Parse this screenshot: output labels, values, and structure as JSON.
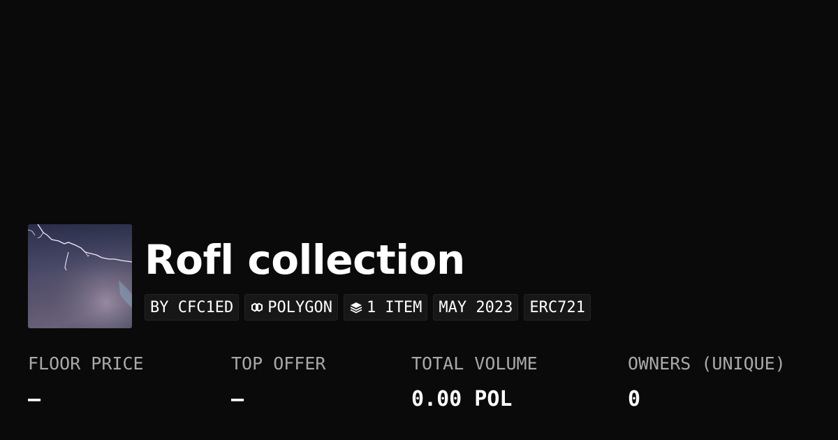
{
  "collection": {
    "name": "Rofl collection",
    "chips": {
      "creator": "BY CFC1ED",
      "chain": "POLYGON",
      "items": "1 ITEM",
      "date": "MAY 2023",
      "standard": "ERC721"
    },
    "thumbnail": {
      "icon": "lightning-storm-image"
    }
  },
  "stats": {
    "floor_price": {
      "label": "FLOOR PRICE",
      "value": "–"
    },
    "top_offer": {
      "label": "TOP OFFER",
      "value": "–"
    },
    "total_volume": {
      "label": "TOTAL VOLUME",
      "value": "0.00 POL"
    },
    "owners": {
      "label": "OWNERS (UNIQUE)",
      "value": "0"
    }
  },
  "colors": {
    "background": "#0a0a0a",
    "chip_background": "#171717",
    "label_gray": "#a9a9a9",
    "text": "#ffffff"
  }
}
